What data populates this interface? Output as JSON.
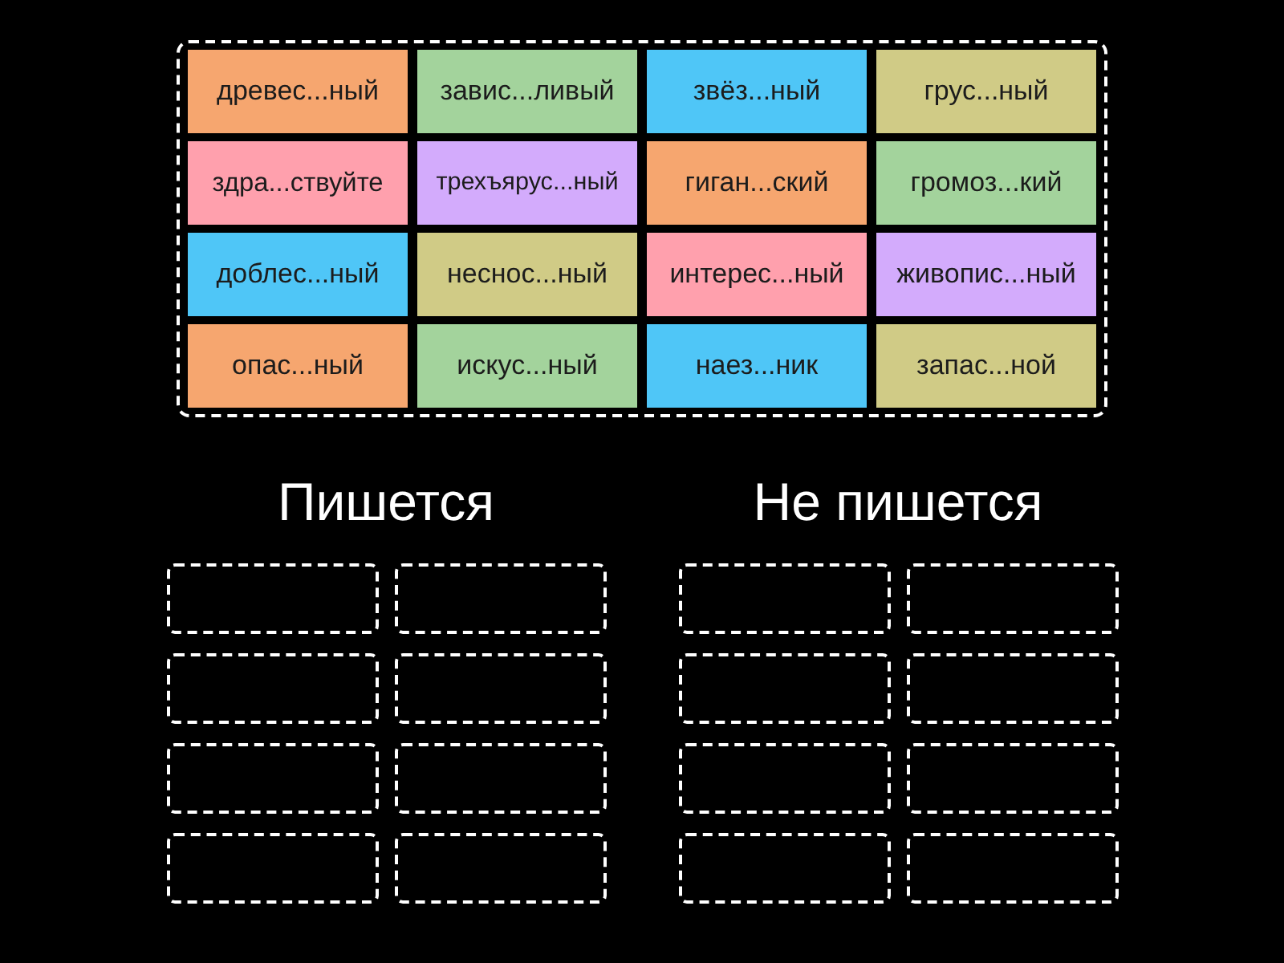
{
  "cards": [
    {
      "text": "древес...ный",
      "color": "#f6a66f"
    },
    {
      "text": "завис...ливый",
      "color": "#a3d39c"
    },
    {
      "text": "звёз...ный",
      "color": "#4fc6f7"
    },
    {
      "text": "грус...ный",
      "color": "#d0cb86"
    },
    {
      "text": "здра...ствуйте",
      "color": "#ffa0ad"
    },
    {
      "text": "трехъярус...ный",
      "color": "#d3abfc"
    },
    {
      "text": "гиган...ский",
      "color": "#f6a66f"
    },
    {
      "text": "громоз...кий",
      "color": "#a3d39c"
    },
    {
      "text": "доблес...ный",
      "color": "#4fc6f7"
    },
    {
      "text": "неснос...ный",
      "color": "#d0cb86"
    },
    {
      "text": "интерес...ный",
      "color": "#ffa0ad"
    },
    {
      "text": "живопис...ный",
      "color": "#d3abfc"
    },
    {
      "text": "опас...ный",
      "color": "#f6a66f"
    },
    {
      "text": "искус...ный",
      "color": "#a3d39c"
    },
    {
      "text": "наез...ник",
      "color": "#4fc6f7"
    },
    {
      "text": "запас...ной",
      "color": "#d0cb86"
    }
  ],
  "groups": [
    {
      "title": "Пишется",
      "slots": [
        {
          "kind": "empty"
        },
        {
          "kind": "empty"
        },
        {
          "kind": "empty"
        },
        {
          "kind": "empty"
        },
        {
          "kind": "empty"
        },
        {
          "kind": "empty"
        },
        {
          "kind": "empty"
        },
        {
          "kind": "empty"
        }
      ]
    },
    {
      "title": "Не пишется",
      "slots": [
        {
          "kind": "empty"
        },
        {
          "kind": "empty"
        },
        {
          "kind": "empty"
        },
        {
          "kind": "empty"
        },
        {
          "kind": "empty"
        },
        {
          "kind": "empty"
        },
        {
          "kind": "empty"
        },
        {
          "kind": "empty"
        }
      ]
    }
  ]
}
